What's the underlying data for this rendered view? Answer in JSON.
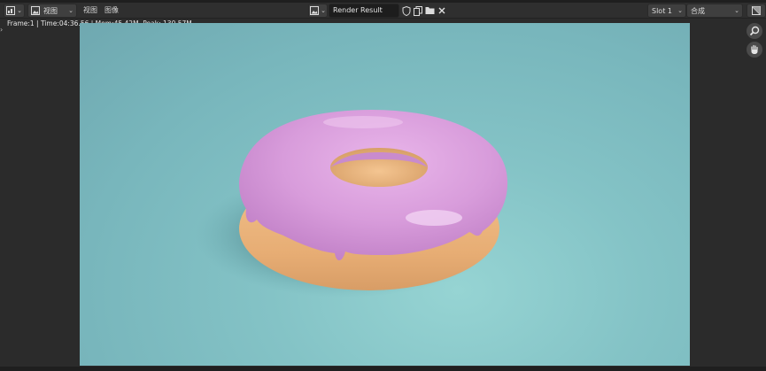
{
  "header": {
    "view_mode": "视图",
    "menus": [
      "视图",
      "图像"
    ],
    "image_name": "Render Result",
    "slot": "Slot 1",
    "layer": "合成"
  },
  "info_text": "Frame:1 | Time:04:36.56 | Mem:45.42M, Peak: 130.57M",
  "icons": {
    "editor_type": "image-editor-icon",
    "image_browse": "image-browse-icon",
    "fake_user": "shield-icon",
    "duplicate": "duplicate-icon",
    "open": "folder-icon",
    "close": "close-icon",
    "zoom": "zoom-icon",
    "pan": "hand-icon",
    "display_channels": "channels-icon"
  },
  "colors": {
    "background": "#2b2b2b",
    "render_bg": "#84c3c6",
    "icing": "#d59bd9",
    "dough": "#eab57c"
  }
}
